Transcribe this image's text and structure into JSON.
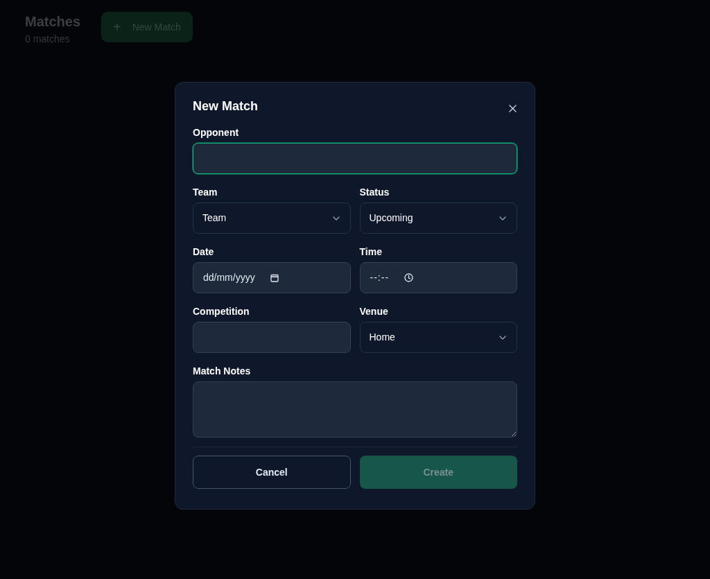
{
  "page": {
    "title": "Matches",
    "subtitle": "0 matches",
    "new_button": {
      "label": "New Match",
      "icon": "+"
    }
  },
  "dialog": {
    "title": "New Match",
    "fields": [
      {
        "kind": "text",
        "label": "Opponent",
        "focused": true,
        "wide": true
      },
      {
        "kind": "select",
        "label": "Team",
        "value": "Team",
        "focused": false,
        "wide": false
      },
      {
        "kind": "select",
        "label": "Status",
        "value": "Upcoming",
        "focused": false,
        "wide": false
      },
      {
        "kind": "date",
        "label": "Date",
        "placeholder": "dd/mm/yyyy",
        "focused": false,
        "wide": false
      },
      {
        "kind": "time",
        "label": "Time",
        "placeholder": "--:--",
        "focused": false,
        "wide": false
      },
      {
        "kind": "text",
        "label": "Competition",
        "focused": false,
        "wide": false
      },
      {
        "kind": "select",
        "label": "Venue",
        "value": "Home",
        "focused": false,
        "wide": false
      },
      {
        "kind": "textarea",
        "label": "Match Notes",
        "focused": false,
        "wide": true
      }
    ],
    "buttons": [
      {
        "kind": "secondary",
        "label": "Cancel",
        "disabled": false
      },
      {
        "kind": "primary",
        "label": "Create",
        "disabled": true
      }
    ]
  }
}
